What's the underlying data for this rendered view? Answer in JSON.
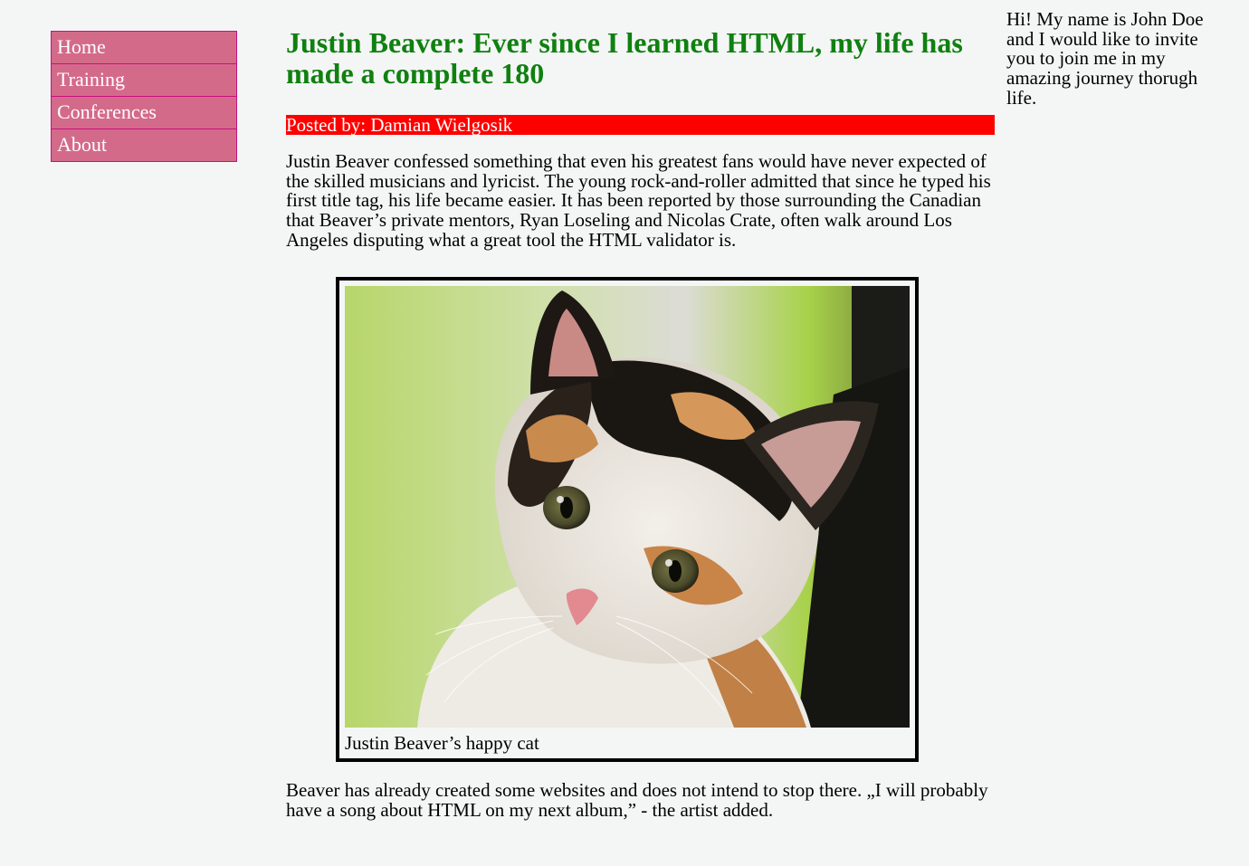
{
  "nav": {
    "items": [
      {
        "label": "Home"
      },
      {
        "label": "Training"
      },
      {
        "label": "Conferences"
      },
      {
        "label": "About"
      }
    ]
  },
  "article": {
    "title": "Justin Beaver: Ever since I learned HTML, my life has made a complete 180",
    "posted_by": "Posted by: Damian Wielgosik",
    "paragraph_1": "Justin Beaver confessed something that even his greatest fans would have never expected of the skilled musicians and lyricist. The young rock-and-roller admitted that since he typed his first title tag, his life became easier. It has been reported by those surrounding the Canadian that Beaver’s private mentors, Ryan Loseling and Nicolas Crate, often walk around Los Angeles disputing what a great tool the HTML validator is.",
    "figure_caption": "Justin Beaver’s happy cat",
    "paragraph_2": "Beaver has already created some websites and does not intend to stop there. „I will probably have a song about HTML on my next album,” - the artist added."
  },
  "sidebar": {
    "text": "Hi! My name is John Doe and I would like to invite you to join me in my amazing journey thorugh life."
  },
  "colors": {
    "background": "#f4f6f5",
    "nav_bg": "#d46a8a",
    "nav_border": "#c8117e",
    "title": "#108010",
    "posted_bg": "#ff0000"
  }
}
